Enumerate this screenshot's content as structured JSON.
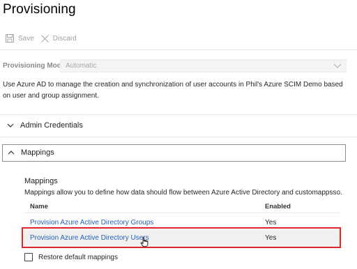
{
  "page": {
    "title": "Provisioning"
  },
  "toolbar": {
    "save_label": "Save",
    "discard_label": "Discard"
  },
  "provisioning_mode": {
    "label": "Provisioning Mode",
    "value": "Automatic"
  },
  "description": "Use Azure AD to manage the creation and synchronization of user accounts in Phil's Azure SCIM Demo based on user and group assignment.",
  "sections": {
    "admin_credentials": "Admin Credentials",
    "mappings": "Mappings"
  },
  "mappings": {
    "heading": "Mappings",
    "subtext": "Mappings allow you to define how data should flow between Azure Active Directory and customappsso.",
    "columns": {
      "name": "Name",
      "enabled": "Enabled"
    },
    "rows": [
      {
        "name": "Provision Azure Active Directory Groups",
        "enabled": "Yes"
      },
      {
        "name": "Provision Azure Active Directory Users",
        "enabled": "Yes"
      }
    ],
    "restore_label": "Restore default mappings",
    "restore_checked": false
  },
  "colors": {
    "link": "#2561b5",
    "highlight_border": "#e0262a",
    "disabled_text": "#a0a0a0"
  },
  "icons": {
    "save": "save-icon",
    "discard": "close-icon",
    "collapsed": "chevron-right-icon",
    "expanded": "chevron-up-icon",
    "dropdown": "chevron-down-icon",
    "cursor": "hand-pointer-icon"
  }
}
